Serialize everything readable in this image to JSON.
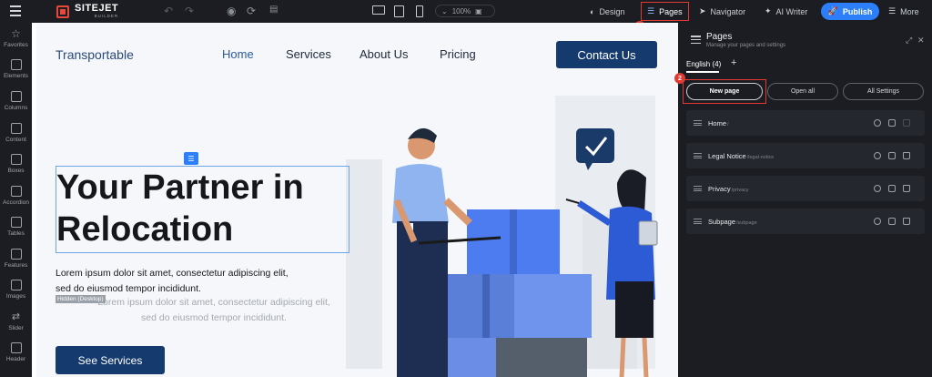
{
  "topbar": {
    "logo_main": "SITEJET",
    "logo_sub": "BUILDER",
    "zoom": "100%",
    "design_label": "Design",
    "pages_label": "Pages",
    "navigator_label": "Navigator",
    "aiwriter_label": "AI Writer",
    "publish_label": "Publish",
    "more_label": "More",
    "accent": "#2d7ff9",
    "highlight": "#e03a32"
  },
  "sidebar": {
    "items": [
      {
        "label": "Favorites",
        "icon": "star-icon"
      },
      {
        "label": "Elements",
        "icon": "elements-icon"
      },
      {
        "label": "Columns",
        "icon": "columns-icon"
      },
      {
        "label": "Content",
        "icon": "content-icon"
      },
      {
        "label": "Boxes",
        "icon": "boxes-icon"
      },
      {
        "label": "Accordion",
        "icon": "accordion-icon"
      },
      {
        "label": "Tables",
        "icon": "table-icon"
      },
      {
        "label": "Features",
        "icon": "features-icon"
      },
      {
        "label": "Images",
        "icon": "image-icon"
      },
      {
        "label": "Slider",
        "icon": "slider-icon"
      },
      {
        "label": "Header",
        "icon": "header-icon"
      }
    ]
  },
  "site": {
    "logo": "Transportable",
    "nav": [
      "Home",
      "Services",
      "About Us",
      "Pricing"
    ],
    "contact": "Contact Us",
    "headline_1": "Your Partner in",
    "headline_2": "Relocation",
    "lorem_1": "Lorem ipsum dolor sit amet, consectetur adipiscing elit,",
    "lorem_2": "sed do eiusmod tempor incididunt.",
    "hidden_tag": "Hidden (Desktop)",
    "ghost_1": "Lorem ipsum dolor sit amet, consectetur adipiscing elit,",
    "ghost_2": "sed do eiusmod tempor incididunt.",
    "cta": "See Services",
    "brand_color": "#143a6e"
  },
  "panel": {
    "title": "Pages",
    "subtitle": "Manage your pages and settings",
    "lang_tab": "English (4)",
    "add": "+",
    "new_page": "New page",
    "open_all": "Open all",
    "all_settings": "All Settings",
    "pages": [
      {
        "name": "Home",
        "path": "/"
      },
      {
        "name": "Legal Notice",
        "path": "/legal-notice"
      },
      {
        "name": "Privacy",
        "path": "/privacy"
      },
      {
        "name": "Subpage",
        "path": "/subpage"
      }
    ]
  },
  "badges": {
    "one": "1",
    "two": "2"
  }
}
